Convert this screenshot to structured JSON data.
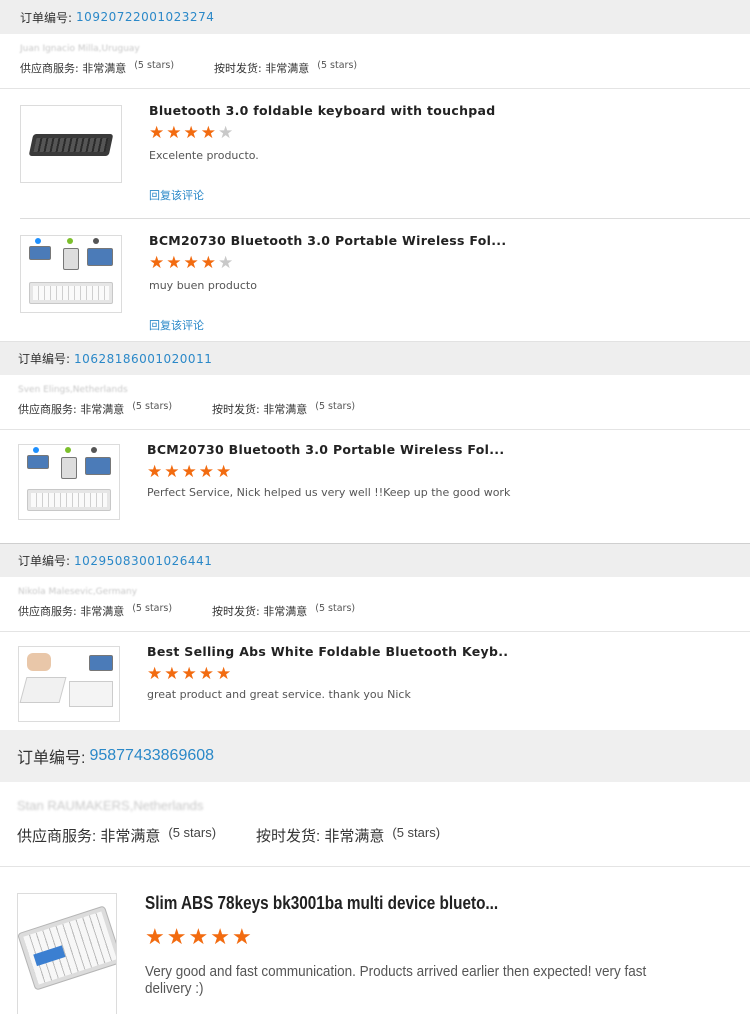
{
  "labels": {
    "order_no": "订单编号:",
    "supplier_service": "供应商服务:",
    "on_time_shipping": "按时发货:",
    "very_satisfied": "非常满意",
    "five_stars": "(5 stars)",
    "reply_review": "回复该评论"
  },
  "colors": {
    "accent": "#2a88c8",
    "star": "#f26b10",
    "star_off": "#c9c9c9"
  },
  "orders": [
    {
      "order_number": "10920722001023274",
      "buyer": "Juan Ignacio Milla,Uruguay",
      "products": [
        {
          "title": "Bluetooth 3.0 foldable keyboard with touchpad",
          "stars": 4,
          "comment": "Excelente producto.",
          "thumb": "black-folding-keyboard"
        },
        {
          "title": "BCM20730 Bluetooth 3.0 Portable Wireless Fol...",
          "stars": 4,
          "comment": "muy buen producto",
          "thumb": "silver-folding-keyboard-devices"
        }
      ]
    },
    {
      "order_number": "10628186001020011",
      "buyer": "Sven Elings,Netherlands",
      "products": [
        {
          "title": "BCM20730 Bluetooth 3.0 Portable Wireless Fol...",
          "stars": 5,
          "comment": "Perfect Service, Nick helped us very well !!Keep up the good work",
          "thumb": "silver-folding-keyboard-devices"
        }
      ]
    },
    {
      "order_number": "10295083001026441",
      "buyer": "Nikola Malesevic,Germany",
      "products": [
        {
          "title": "Best Selling Abs White Foldable Bluetooth Keyb..",
          "stars": 5,
          "comment": "great product and great service. thank you Nick",
          "thumb": "white-foldable-keyboard"
        }
      ]
    },
    {
      "order_number": "95877433869608",
      "buyer": "Stan RAUMAKERS,Netherlands",
      "products": [
        {
          "title": "Slim ABS 78keys bk3001ba multi device blueto...",
          "stars": 5,
          "comment": "Very good and fast communication. Products arrived earlier then expected! very fast delivery :)",
          "thumb": "silver-blue-keyboard"
        }
      ]
    }
  ]
}
